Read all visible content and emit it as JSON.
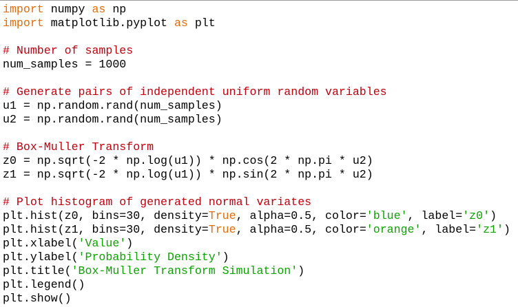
{
  "colors": {
    "background": "#ffffff",
    "text": "#000000",
    "keyword": "#e36c09",
    "comment": "#c0000c",
    "string": "#0ba300"
  },
  "code": {
    "lines": [
      [
        {
          "t": "import",
          "k": "keyword"
        },
        {
          "t": " numpy ",
          "k": "plain"
        },
        {
          "t": "as",
          "k": "keyword"
        },
        {
          "t": " np",
          "k": "plain"
        }
      ],
      [
        {
          "t": "import",
          "k": "keyword"
        },
        {
          "t": " matplotlib.pyplot ",
          "k": "plain"
        },
        {
          "t": "as",
          "k": "keyword"
        },
        {
          "t": " plt",
          "k": "plain"
        }
      ],
      [],
      [
        {
          "t": "# Number of samples",
          "k": "comment"
        }
      ],
      [
        {
          "t": "num_samples = 1000",
          "k": "plain"
        }
      ],
      [],
      [
        {
          "t": "# Generate pairs of independent uniform random variables",
          "k": "comment"
        }
      ],
      [
        {
          "t": "u1 = np.random.rand(num_samples)",
          "k": "plain"
        }
      ],
      [
        {
          "t": "u2 = np.random.rand(num_samples)",
          "k": "plain"
        }
      ],
      [],
      [
        {
          "t": "# Box-Muller Transform",
          "k": "comment"
        }
      ],
      [
        {
          "t": "z0 = np.sqrt(-2 * np.log(u1)) * np.cos(2 * np.pi * u2)",
          "k": "plain"
        }
      ],
      [
        {
          "t": "z1 = np.sqrt(-2 * np.log(u1)) * np.sin(2 * np.pi * u2)",
          "k": "plain"
        }
      ],
      [],
      [
        {
          "t": "# Plot histogram of generated normal variates",
          "k": "comment"
        }
      ],
      [
        {
          "t": "plt.hist(z0, bins=30, density=",
          "k": "plain"
        },
        {
          "t": "True",
          "k": "builtin"
        },
        {
          "t": ", alpha=0.5, color=",
          "k": "plain"
        },
        {
          "t": "'blue'",
          "k": "string"
        },
        {
          "t": ", label=",
          "k": "plain"
        },
        {
          "t": "'z0'",
          "k": "string"
        },
        {
          "t": ")",
          "k": "plain"
        }
      ],
      [
        {
          "t": "plt.hist(z1, bins=30, density=",
          "k": "plain"
        },
        {
          "t": "True",
          "k": "builtin"
        },
        {
          "t": ", alpha=0.5, color=",
          "k": "plain"
        },
        {
          "t": "'orange'",
          "k": "string"
        },
        {
          "t": ", label=",
          "k": "plain"
        },
        {
          "t": "'z1'",
          "k": "string"
        },
        {
          "t": ")",
          "k": "plain"
        }
      ],
      [
        {
          "t": "plt.xlabel(",
          "k": "plain"
        },
        {
          "t": "'Value'",
          "k": "string"
        },
        {
          "t": ")",
          "k": "plain"
        }
      ],
      [
        {
          "t": "plt.ylabel(",
          "k": "plain"
        },
        {
          "t": "'Probability Density'",
          "k": "string"
        },
        {
          "t": ")",
          "k": "plain"
        }
      ],
      [
        {
          "t": "plt.title(",
          "k": "plain"
        },
        {
          "t": "'Box-Muller Transform Simulation'",
          "k": "string"
        },
        {
          "t": ")",
          "k": "plain"
        }
      ],
      [
        {
          "t": "plt.legend()",
          "k": "plain"
        }
      ],
      [
        {
          "t": "plt.show()",
          "k": "plain"
        }
      ]
    ]
  }
}
